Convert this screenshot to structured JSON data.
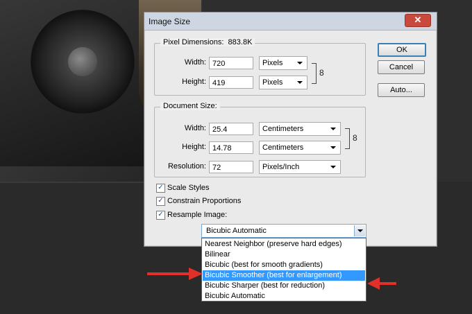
{
  "dialog": {
    "title": "Image Size",
    "close_glyph": "✕",
    "pixel_dimensions": {
      "legend": "Pixel Dimensions:",
      "size": "883.8K",
      "width_label": "Width:",
      "width_value": "720",
      "width_unit": "Pixels",
      "height_label": "Height:",
      "height_value": "419",
      "height_unit": "Pixels"
    },
    "document_size": {
      "legend": "Document Size:",
      "width_label": "Width:",
      "width_value": "25.4",
      "width_unit": "Centimeters",
      "height_label": "Height:",
      "height_value": "14.78",
      "height_unit": "Centimeters",
      "resolution_label": "Resolution:",
      "resolution_value": "72",
      "resolution_unit": "Pixels/Inch"
    },
    "buttons": {
      "ok": "OK",
      "cancel": "Cancel",
      "auto": "Auto..."
    },
    "checkboxes": {
      "scale_styles": "Scale Styles",
      "constrain": "Constrain Proportions",
      "resample": "Resample Image:"
    },
    "checkmark": "✓",
    "chain_glyph": "8",
    "resample_select": {
      "value": "Bicubic Automatic",
      "options": [
        "Nearest Neighbor (preserve hard edges)",
        "Bilinear",
        "Bicubic (best for smooth gradients)",
        "Bicubic Smoother (best for enlargement)",
        "Bicubic Sharper (best for reduction)",
        "Bicubic Automatic"
      ],
      "highlighted_index": 3
    }
  },
  "annotation_color": "#e0302a"
}
